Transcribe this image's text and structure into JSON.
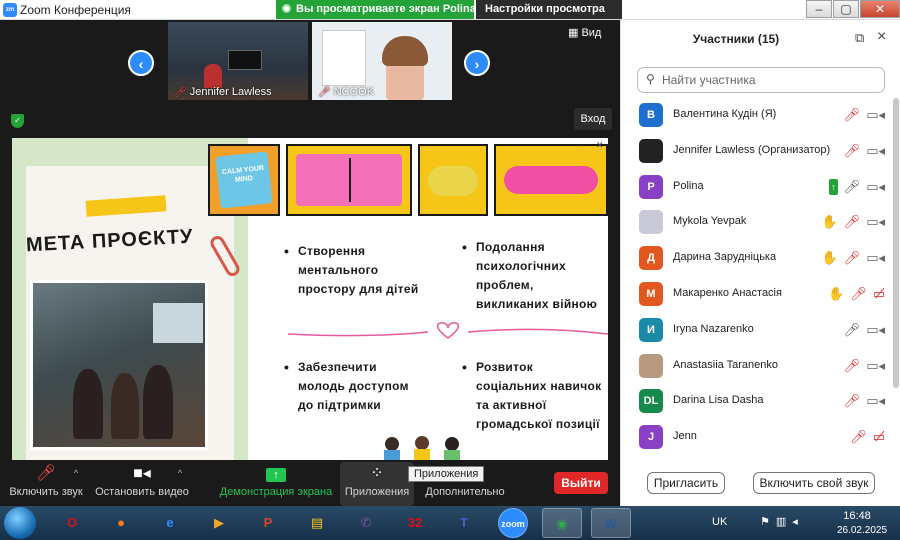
{
  "window": {
    "title": "Zoom Конференция",
    "logo_text": "zm",
    "share_banner": "Вы просматриваете экран Polina",
    "view_settings": "Настройки просмотра",
    "controls": [
      "–",
      "▢",
      "✕"
    ]
  },
  "meeting": {
    "view_label": "Вид",
    "exit_fullscreen_label": "Вход",
    "thumbnails": [
      {
        "name": "Jennifer Lawless"
      },
      {
        "name": "NCOOK"
      }
    ]
  },
  "slide": {
    "title": "МЕТА ПРОЄКТУ",
    "sticker_card_text": "CALM YOUR MIND",
    "items": [
      "Створення\nментального\nпростору для дітей",
      "Подолання\nпсихологічних\nпроблем,\nвикликаних війною",
      "Забезпечити\nмолодь доступом\nдо підтримки",
      "Розвиток\nсоціальних навичок\nта активної\nгромадської позиції"
    ]
  },
  "toolbar": {
    "mic_label": "Включить звук",
    "video_label": "Остановить видео",
    "share_label": "Демонстрация экрана",
    "apps_label": "Приложения",
    "more_label": "Дополнительно",
    "tooltip": "Приложения",
    "end_label": "Выйти"
  },
  "participants": {
    "title": "Участники (15)",
    "search_placeholder": "Найти участника",
    "list": [
      {
        "initial": "В",
        "name": "Валентина Кудін (Я)",
        "color": "#1f6fd1",
        "hand": false,
        "sharing": false,
        "mic": "off",
        "cam": "on"
      },
      {
        "initial": "",
        "name": "Jennifer Lawless (Организатор)",
        "color": "#222222",
        "hand": false,
        "sharing": false,
        "mic": "off",
        "cam": "on"
      },
      {
        "initial": "P",
        "name": "Polina",
        "color": "#8a3fc7",
        "hand": false,
        "sharing": true,
        "mic": "on",
        "cam": "on"
      },
      {
        "initial": "",
        "name": "Mykola Yevpak",
        "color": "#c9c9d8",
        "hand": true,
        "sharing": false,
        "mic": "off",
        "cam": "on"
      },
      {
        "initial": "Д",
        "name": "Дарина Зарудніцька",
        "color": "#e0571f",
        "hand": true,
        "sharing": false,
        "mic": "off",
        "cam": "on"
      },
      {
        "initial": "М",
        "name": "Макаренко Анастасія",
        "color": "#e0571f",
        "hand": true,
        "sharing": false,
        "mic": "off",
        "cam": "off"
      },
      {
        "initial": "И",
        "name": "Iryna Nazarenko",
        "color": "#1a8aa8",
        "hand": false,
        "sharing": false,
        "mic": "on",
        "cam": "on"
      },
      {
        "initial": "",
        "name": "Anastasiia Taranenko",
        "color": "#b89a80",
        "hand": false,
        "sharing": false,
        "mic": "off",
        "cam": "on"
      },
      {
        "initial": "DL",
        "name": "Darina Lisa Dasha",
        "color": "#168a4a",
        "hand": false,
        "sharing": false,
        "mic": "off",
        "cam": "on"
      },
      {
        "initial": "J",
        "name": "Jenn",
        "color": "#8a3fc7",
        "hand": false,
        "sharing": false,
        "mic": "off",
        "cam": "off"
      }
    ],
    "invite_label": "Пригласить",
    "unmute_label": "Включить свой звук"
  },
  "taskbar": {
    "apps": [
      {
        "name": "opera",
        "glyph": "O",
        "color": "#d8101c"
      },
      {
        "name": "firefox",
        "glyph": "●",
        "color": "#ff7a1a"
      },
      {
        "name": "internet-explorer",
        "glyph": "e",
        "color": "#2d8cff"
      },
      {
        "name": "media-player",
        "glyph": "▶",
        "color": "#f5a623"
      },
      {
        "name": "powerpoint",
        "glyph": "P",
        "color": "#d24726"
      },
      {
        "name": "file-explorer",
        "glyph": "▤",
        "color": "#f5c518"
      },
      {
        "name": "viber",
        "glyph": "✆",
        "color": "#7b519d"
      },
      {
        "name": "app-badge",
        "glyph": "32",
        "color": "#d8101c"
      },
      {
        "name": "teams",
        "glyph": "T",
        "color": "#5059c9"
      },
      {
        "name": "zoom",
        "glyph": "zoom",
        "color": "#2d8cff"
      },
      {
        "name": "chrome",
        "glyph": "◉",
        "color": "#34a853"
      },
      {
        "name": "word",
        "glyph": "W",
        "color": "#2b579a"
      }
    ],
    "language": "UK",
    "time": "16:48",
    "date": "26.02.2025"
  }
}
